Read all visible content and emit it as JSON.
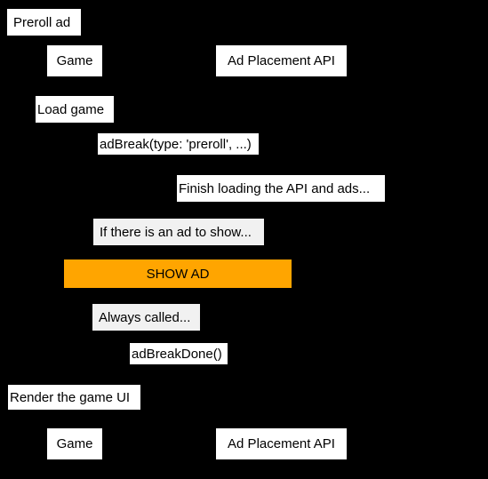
{
  "diagram": {
    "type": "sequence-diagram",
    "background_color": "#000000",
    "box_fill": "#ffffff",
    "note_fill": "#f1f1f1",
    "highlight_fill": "#ffa500",
    "text_color": "#000000",
    "title": "Preroll ad",
    "participants": [
      {
        "id": "game",
        "label": "Game"
      },
      {
        "id": "api",
        "label": "Ad Placement API"
      }
    ],
    "steps": [
      {
        "id": "load-game",
        "kind": "self-message",
        "label": "Load game",
        "from": "game",
        "to": "game"
      },
      {
        "id": "adbreak-call",
        "kind": "message",
        "label": "adBreak(type: 'preroll', ...)",
        "from": "game",
        "to": "api"
      },
      {
        "id": "finish-loading",
        "kind": "self-message",
        "label": "Finish loading the API and ads...",
        "from": "api",
        "to": "api"
      },
      {
        "id": "if-ad-to-show",
        "kind": "note",
        "label": "If there is an ad to show..."
      },
      {
        "id": "show-ad",
        "kind": "highlight",
        "label": "SHOW AD"
      },
      {
        "id": "always-called",
        "kind": "note",
        "label": "Always called..."
      },
      {
        "id": "adbreakdone-call",
        "kind": "message",
        "label": "adBreakDone()",
        "from": "api",
        "to": "game"
      },
      {
        "id": "render-game-ui",
        "kind": "self-message",
        "label": "Render the game UI",
        "from": "game",
        "to": "game"
      }
    ],
    "footer_participants": [
      {
        "id": "game-footer",
        "label": "Game"
      },
      {
        "id": "api-footer",
        "label": "Ad Placement API"
      }
    ]
  }
}
